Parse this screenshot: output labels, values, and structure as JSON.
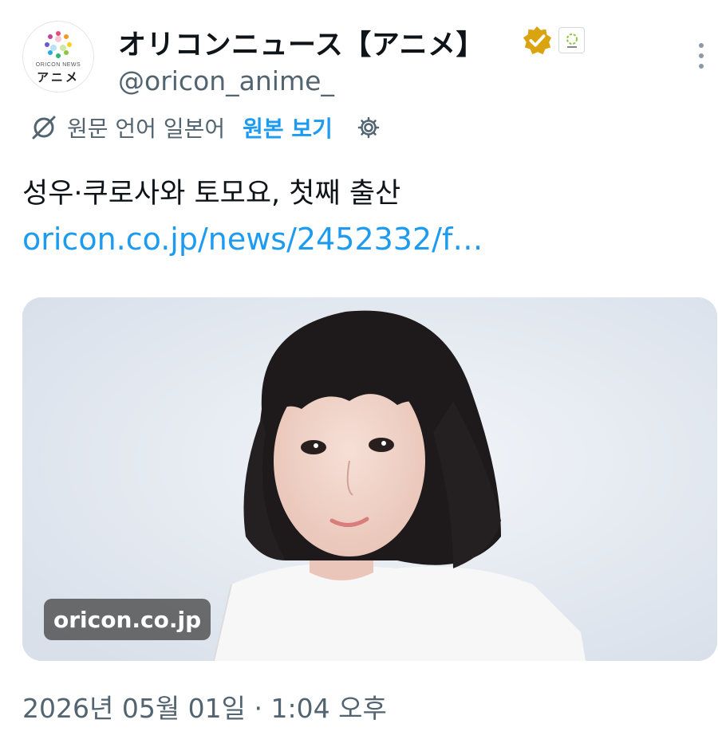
{
  "account": {
    "display_name": "オリコンニュース【アニメ】",
    "handle": "@oricon_anime_",
    "avatar_sub": "ORICON NEWS",
    "avatar_text": "アニメ",
    "verified_icon": "verified-badge-icon",
    "affiliate_icon": "affiliate-logo-icon",
    "verified_color": "#d9a40f"
  },
  "translate": {
    "source_label": "원문 언어 일본어",
    "show_original": "원본 보기",
    "accent_color": "#1d9bf0"
  },
  "tweet": {
    "text": "성우·쿠로사와 토모요, 첫째 출산",
    "link": "oricon.co.jp/news/2452332/f…"
  },
  "media": {
    "domain": "oricon.co.jp"
  },
  "timestamp": "2026년 05월 01일 · 1:04 오후"
}
